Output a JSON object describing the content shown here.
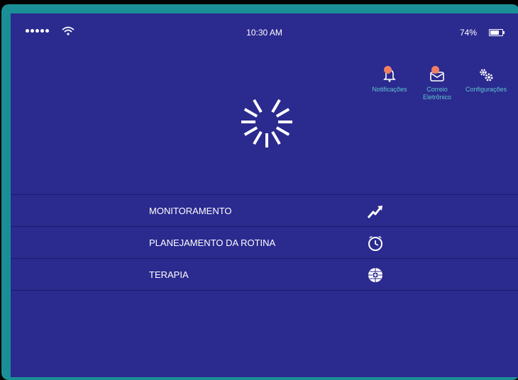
{
  "status": {
    "time": "10:30 AM",
    "battery_percent_text": "74%",
    "battery_level": 0.74
  },
  "top_actions": [
    {
      "icon": "bell-icon",
      "label": "Notificações",
      "badge_color": "#ef7f63"
    },
    {
      "icon": "envelope-icon",
      "label": "Correio Eletrônico",
      "badge_color": "#ef7f63"
    },
    {
      "icon": "gears-icon",
      "label": "Configurações"
    }
  ],
  "menu": [
    {
      "label": "MONITORAMENTO",
      "icon": "trend-chart-icon"
    },
    {
      "label": "PLANEJAMENTO DA ROTINA",
      "icon": "alarm-clock-icon"
    },
    {
      "label": "TERAPIA",
      "icon": "globe-cross-icon"
    }
  ],
  "colors": {
    "screen_bg": "#2b2a8f",
    "accent": "#5fc7cf",
    "bezel": "#1b8f96",
    "badge": "#ef7f63"
  }
}
